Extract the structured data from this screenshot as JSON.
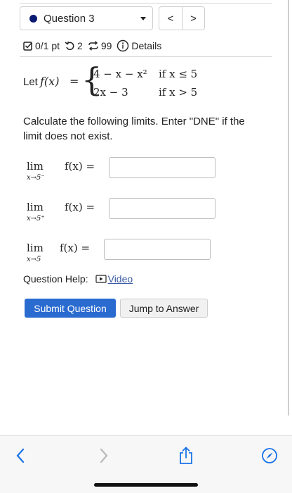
{
  "question_select": {
    "label": "Question 3"
  },
  "nav": {
    "prev": "<",
    "next": ">"
  },
  "meta": {
    "score": "0/1 pt",
    "retries": "2",
    "attempts": "99",
    "details": "Details"
  },
  "problem": {
    "let": "Let",
    "fx": "f(x)",
    "eq": "=",
    "case1_expr": "4 − x − x²",
    "case1_cond": "if  x ≤ 5",
    "case2_expr": "2x − 3",
    "case2_cond": "if  x > 5"
  },
  "instructions": "Calculate the following limits. Enter \"DNE\" if the limit does not exist.",
  "limits": [
    {
      "lim": "lim",
      "sub": "x→5⁻",
      "expr": "f(x) =",
      "value": ""
    },
    {
      "lim": "lim",
      "sub": "x→5⁺",
      "expr": "f(x) =",
      "value": ""
    },
    {
      "lim": "lim",
      "sub": "x→5",
      "expr": "f(x) =",
      "value": ""
    }
  ],
  "help": {
    "label": "Question Help:",
    "video": "Video"
  },
  "buttons": {
    "submit": "Submit Question",
    "jump": "Jump to Answer"
  },
  "colors": {
    "accent": "#2a6bd0",
    "dot": "#0a1a72",
    "ios_blue": "#1a73e8"
  }
}
